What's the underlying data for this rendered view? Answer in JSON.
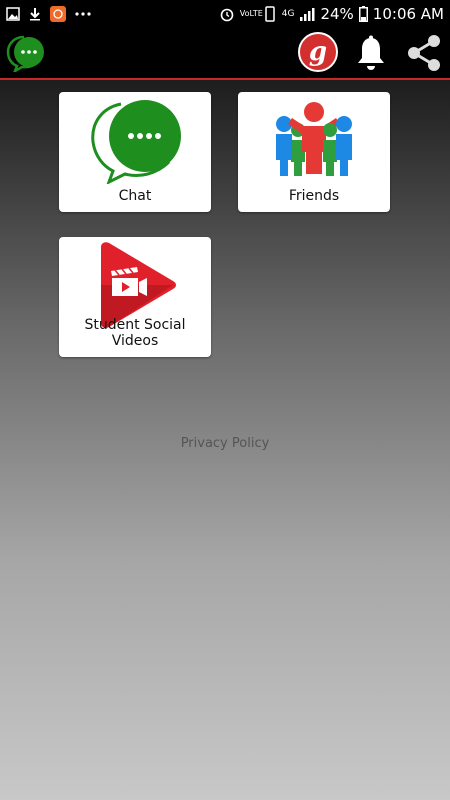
{
  "status_bar": {
    "icons_left": [
      "image-icon",
      "download-icon",
      "app-notification-icon",
      "more-dots-icon"
    ],
    "network": "VoLTE",
    "network_type": "4G",
    "battery": "24%",
    "time": "10:06 AM"
  },
  "app_bar": {
    "icons": [
      "chat-logo-icon",
      "brand-logo-icon",
      "bell-icon",
      "share-icon"
    ],
    "brand_letter": "g"
  },
  "tiles": [
    {
      "label": "Chat",
      "icon": "chat-bubble-icon",
      "color": "#1e8e1e"
    },
    {
      "label": "Friends",
      "icon": "friends-group-icon",
      "color": "#d32f2f"
    },
    {
      "label": "Student Social Videos",
      "icon": "video-play-icon",
      "color": "#d32f2f"
    }
  ],
  "privacy_link": "Privacy Policy"
}
